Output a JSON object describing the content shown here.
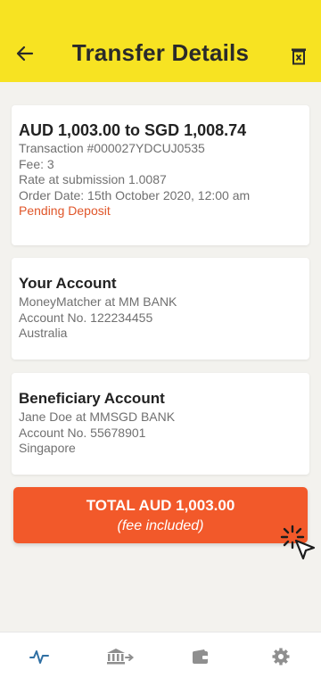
{
  "header": {
    "title": "Transfer Details",
    "back_icon": "arrow-left-icon",
    "delete_icon": "trash-icon"
  },
  "transfer": {
    "title": "AUD 1,003.00 to SGD 1,008.74",
    "transaction": "Transaction #000027YDCUJ0535",
    "fee": "Fee: 3",
    "rate": "Rate at submission 1.0087",
    "order_date": "Order Date: 15th October 2020, 12:00 am",
    "status": "Pending Deposit"
  },
  "your_account": {
    "title": "Your Account",
    "bank": "MoneyMatcher at MM BANK",
    "account_no": "Account No. 122234455",
    "country": "Australia"
  },
  "beneficiary": {
    "title": "Beneficiary Account",
    "bank": "Jane Doe at MMSGD BANK",
    "account_no": "Account No. 55678901",
    "country": "Singapore"
  },
  "total": {
    "label": "TOTAL AUD 1,003.00",
    "sub": "(fee included)"
  },
  "nav": {
    "items": [
      "activity-icon",
      "bank-transfer-icon",
      "wallet-icon",
      "settings-icon"
    ]
  },
  "colors": {
    "header_bg": "#f7e322",
    "accent": "#f2592a",
    "pending": "#e0562a",
    "nav_active": "#2f6fa3",
    "nav_inactive": "#9a9a9a"
  }
}
